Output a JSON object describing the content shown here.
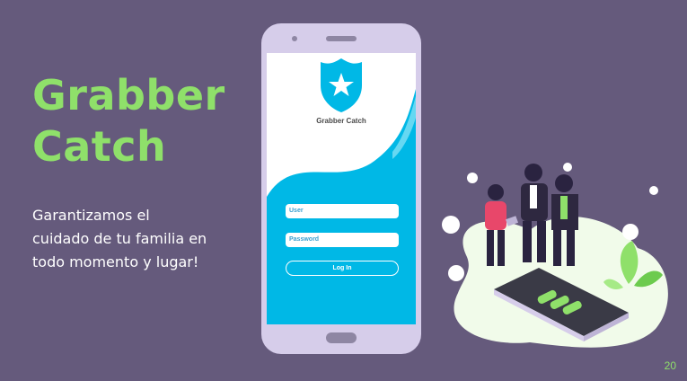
{
  "slide": {
    "title_line1": "Grabber",
    "title_line2": "Catch",
    "subtitle_lines": [
      "Garantizamos el",
      "cuidado de tu familia en",
      "todo momento y lugar!"
    ],
    "page_number": "20"
  },
  "phone_app": {
    "app_name": "Grabber Catch",
    "user_placeholder": "User",
    "password_placeholder": "Password",
    "login_label": "Log In"
  },
  "colors": {
    "background": "#655A7C",
    "accent_green": "#8FE06A",
    "app_cyan": "#00B8E6",
    "phone_body": "#D6CDEA"
  },
  "icons": [
    "shield-star-icon",
    "people-illustration",
    "plant-icon"
  ]
}
